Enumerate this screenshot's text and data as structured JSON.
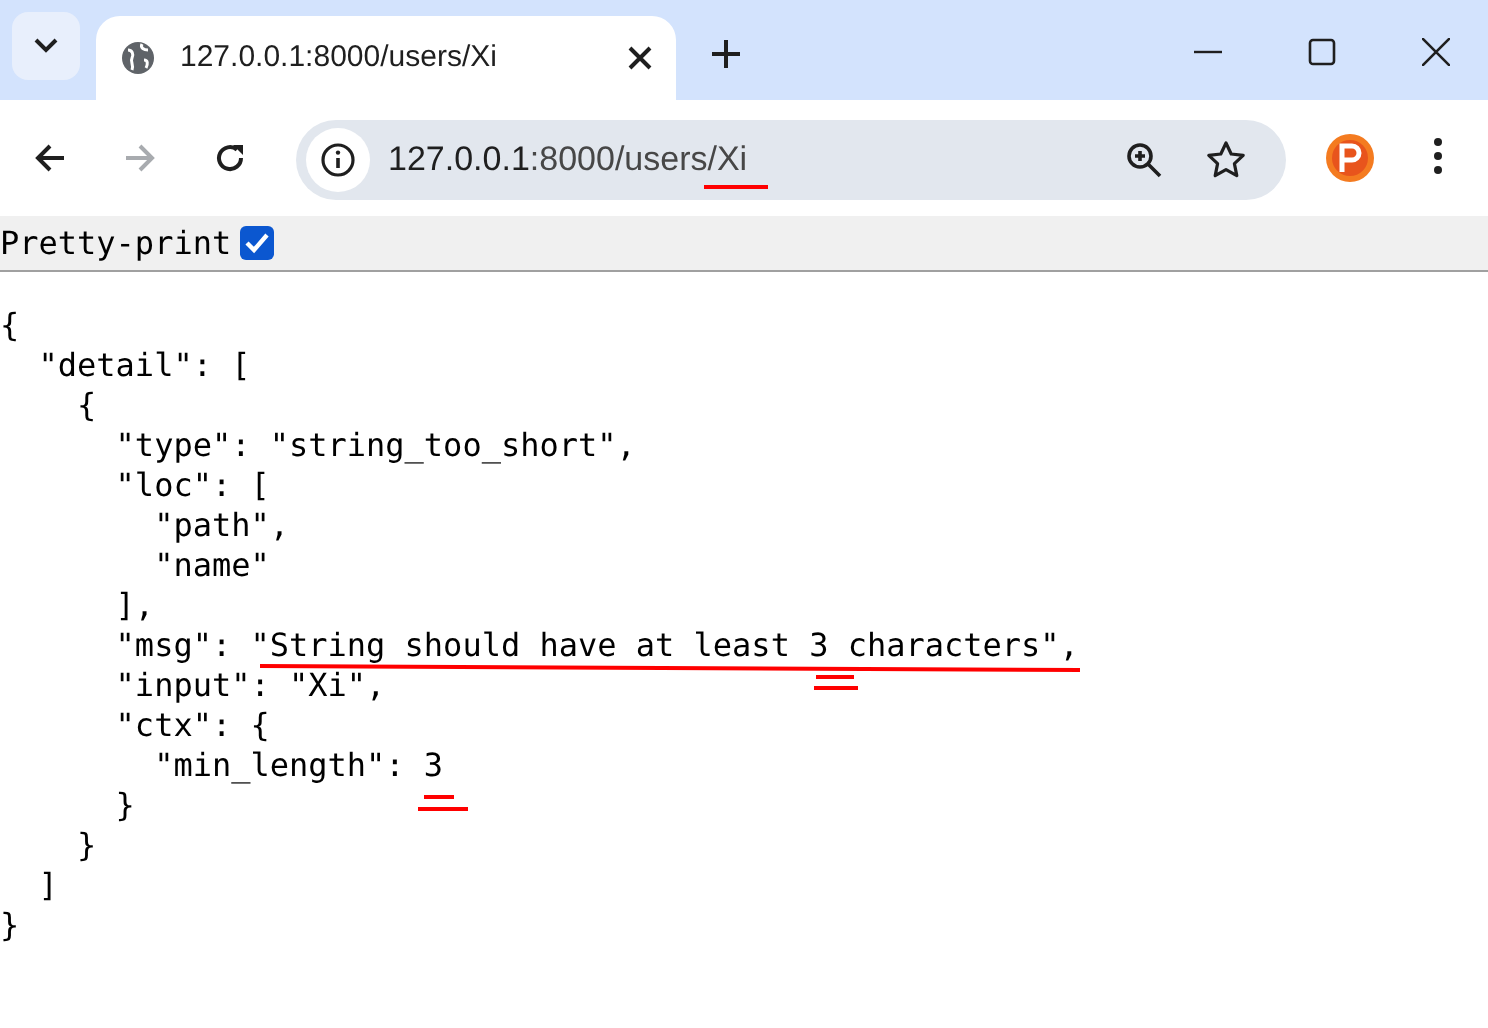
{
  "tab": {
    "title": "127.0.0.1:8000/users/Xi",
    "selected": true
  },
  "address_bar": {
    "host": "127.0.0.1",
    "rest": ":8000/users/Xi"
  },
  "pretty_print": {
    "label": "Pretty-print",
    "checked": true
  },
  "code_lines": [
    "{",
    "  \"detail\": [",
    "    {",
    "      \"type\": \"string_too_short\",",
    "      \"loc\": [",
    "        \"path\",",
    "        \"name\"",
    "      ],",
    "      \"msg\": \"String should have at least 3 characters\",",
    "      \"input\": \"Xi\",",
    "      \"ctx\": {",
    "        \"min_length\": 3",
    "      }",
    "    }",
    "  ]",
    "}"
  ]
}
